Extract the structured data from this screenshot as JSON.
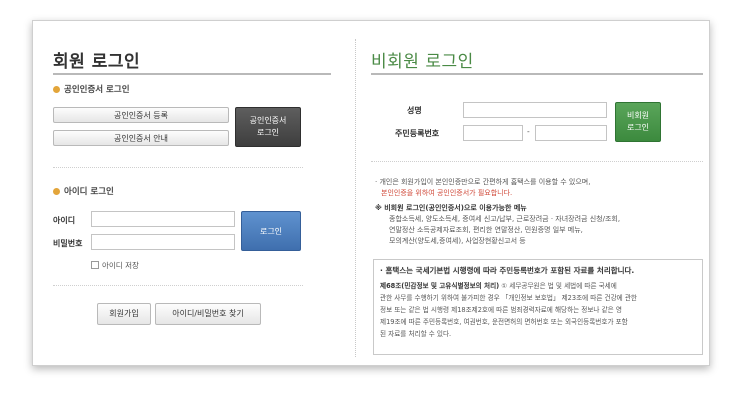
{
  "member": {
    "title": "회원 로그인",
    "cert_section_title": "공인인증서 로그인",
    "cert_register_label": "공인인증서 등록",
    "cert_guide_label": "공인인증서 안내",
    "cert_login_label_line1": "공인인증서",
    "cert_login_label_line2": "로그인",
    "id_section_title": "아이디 로그인",
    "id_label": "아이디",
    "password_label": "비밀번호",
    "id_value": "",
    "password_value": "",
    "login_label": "로그인",
    "save_id_label": "아이디 저장",
    "join_label": "회원가입",
    "find_label": "아이디/비밀번호 찾기"
  },
  "guest": {
    "title": "비회원 로그인",
    "name_label": "성명",
    "rrn_label": "주민등록번호",
    "rrn_separator": "-",
    "name_value": "",
    "rrn_front_value": "",
    "rrn_back_value": "",
    "login_line1": "비회원",
    "login_line2": "로그인",
    "notice_line1": "· 개인은 회원가입이 본인인증만으로 간편하게 홈택스를 이용할 수 있으며,",
    "notice_line2": "본인인증을 위하여 공인인증서가 필요합니다.",
    "menu_title": "※ 비회원 로그인(공인인증서)으로 이용가능한 메뉴",
    "menu_line1": "종합소득세, 양도소득세, 증여세 신고/납부, 근로장려금 · 자녀장려금 신청/조회,",
    "menu_line2": "연말정산 소득공제자료조회, 편리한 연말정산, 민원증명 일부 메뉴,",
    "menu_line3": "모의계산(양도세,증여세), 사업장현황신고서 등",
    "box_title": "· 홈택스는 국세기본법 시행령에 따라 주민등록번호가 포함된 자료를 처리합니다.",
    "box_bold": "제68조(민감정보 및 고유식별정보의 처리)",
    "box_line1": "① 세무공무원은 법 및 세법에 따른 국세에",
    "box_line2": "관한 사무를 수행하기 위하여 불가피한 경우 「개인정보 보호법」 제23조에 따른 건강에 관한",
    "box_line3": "정보 또는 같은 법 시행령 제18조제2호에 따른 범죄경력자료에 해당하는 정보나 같은 영",
    "box_line4": "제19조에 따른 주민등록번호, 여권번호, 운전면허의 면허번호 또는 외국인등록번호가 포함",
    "box_line5": "된 자료를 처리할 수 있다."
  }
}
